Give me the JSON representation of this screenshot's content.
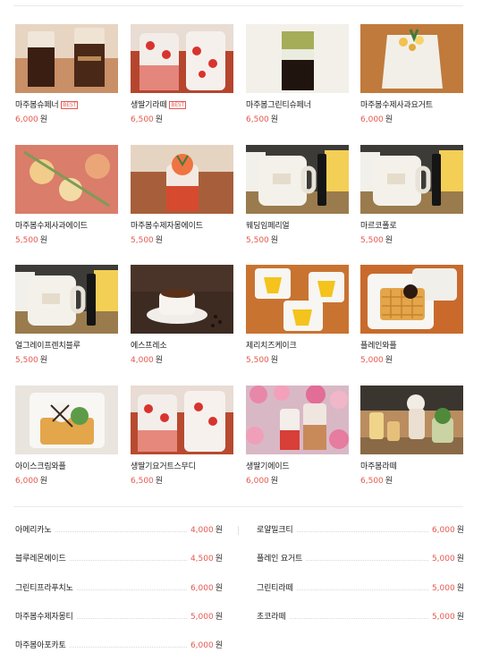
{
  "currency_unit": "원",
  "menu_grid": [
    {
      "name": "마주봄슈페너",
      "price": "6,000",
      "badge": "BEST",
      "icon": "iced-coffee-cream-photo"
    },
    {
      "name": "생딸기라떼",
      "price": "6,500",
      "badge": "BEST",
      "icon": "strawberry-latte-photo"
    },
    {
      "name": "마주봄그린티슈페너",
      "price": "6,500",
      "badge": "",
      "icon": "greentea-einspanner-photo"
    },
    {
      "name": "마주봄수제사과요거트",
      "price": "6,000",
      "badge": "",
      "icon": "apple-yogurt-photo"
    },
    {
      "name": "마주봄수제사과에이드",
      "price": "5,500",
      "badge": "",
      "icon": "apple-ade-photo"
    },
    {
      "name": "마주봄수제자몽에이드",
      "price": "5,500",
      "badge": "",
      "icon": "grapefruit-ade-photo"
    },
    {
      "name": "웨딩임페리얼",
      "price": "5,500",
      "badge": "",
      "icon": "tea-mug-photo"
    },
    {
      "name": "마르코폴로",
      "price": "5,500",
      "badge": "",
      "icon": "tea-mug-photo"
    },
    {
      "name": "얼그레이프렌치블루",
      "price": "5,500",
      "badge": "",
      "icon": "tea-mug-photo"
    },
    {
      "name": "에스프레소",
      "price": "4,000",
      "badge": "",
      "icon": "espresso-cup-photo"
    },
    {
      "name": "제리치즈케이크",
      "price": "5,500",
      "badge": "",
      "icon": "cheesecake-photo"
    },
    {
      "name": "플레인와플",
      "price": "5,000",
      "badge": "",
      "icon": "waffle-photo"
    },
    {
      "name": "아이스크림와플",
      "price": "6,000",
      "badge": "",
      "icon": "icecream-waffle-photo"
    },
    {
      "name": "생딸기요거트스무디",
      "price": "6,500",
      "badge": "",
      "icon": "strawberry-smoothie-photo"
    },
    {
      "name": "생딸기에이드",
      "price": "6,000",
      "badge": "",
      "icon": "strawberry-ade-photo"
    },
    {
      "name": "마주봄라떼",
      "price": "6,500",
      "badge": "",
      "icon": "majubom-latte-photo"
    }
  ],
  "menu_list": [
    {
      "name": "아메리카노",
      "price": "4,000"
    },
    {
      "name": "로얄밀크티",
      "price": "6,000"
    },
    {
      "name": "블루레몬에이드",
      "price": "4,500"
    },
    {
      "name": "플레인 요거트",
      "price": "5,000"
    },
    {
      "name": "그린티프라푸치노",
      "price": "6,000"
    },
    {
      "name": "그린티라떼",
      "price": "5,000"
    },
    {
      "name": "마주봄수제자몽티",
      "price": "5,000"
    },
    {
      "name": "초코라떼",
      "price": "5,000"
    },
    {
      "name": "마주봄아포카토",
      "price": "6,000"
    }
  ],
  "colors": {
    "price": "#e4594f",
    "badge": "#e35b52",
    "divider": "#e9e9e9"
  }
}
